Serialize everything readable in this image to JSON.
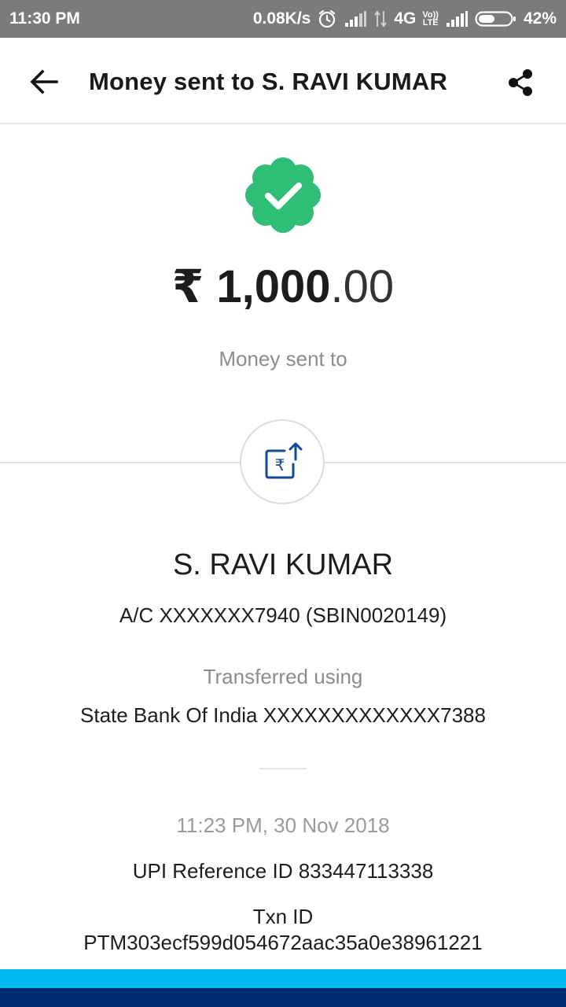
{
  "status_bar": {
    "time": "11:30 PM",
    "speed": "0.08K/s",
    "network": "4G",
    "volte_top": "Vo))",
    "volte_bottom": "LTE",
    "battery": "42%",
    "icons": [
      "alarm-icon",
      "signal-icon",
      "data-arrows-icon",
      "volte-icon",
      "signal-icon",
      "battery-icon"
    ],
    "battery_level": 0.42
  },
  "app_bar": {
    "title": "Money sent to S. RAVI KUMAR",
    "back_icon": "back-arrow-icon",
    "share_icon": "share-icon"
  },
  "transaction": {
    "status_icon": "verified-check-icon",
    "status_color": "#2fbe76",
    "currency_symbol": "₹",
    "amount_main": "1,000",
    "amount_decimal": ".00",
    "sent_to_caption": "Money sent to",
    "transfer_icon": "rupee-transfer-icon",
    "transfer_icon_color": "#0f4a9c",
    "recipient_name": "S. RAVI KUMAR",
    "account": "A/C XXXXXXX7940 (SBIN0020149)",
    "transferred_caption": "Transferred using",
    "source_account": "State Bank Of India XXXXXXXXXXXXX7388",
    "timestamp": "11:23 PM, 30 Nov 2018",
    "upi_reference": "UPI Reference ID 833447113338",
    "txn_label": "Txn ID",
    "txn_id": "PTM303ecf599d054672aac35a0e38961221"
  },
  "footer": {
    "light_color": "#00b9f1",
    "dark_color": "#012b72"
  }
}
